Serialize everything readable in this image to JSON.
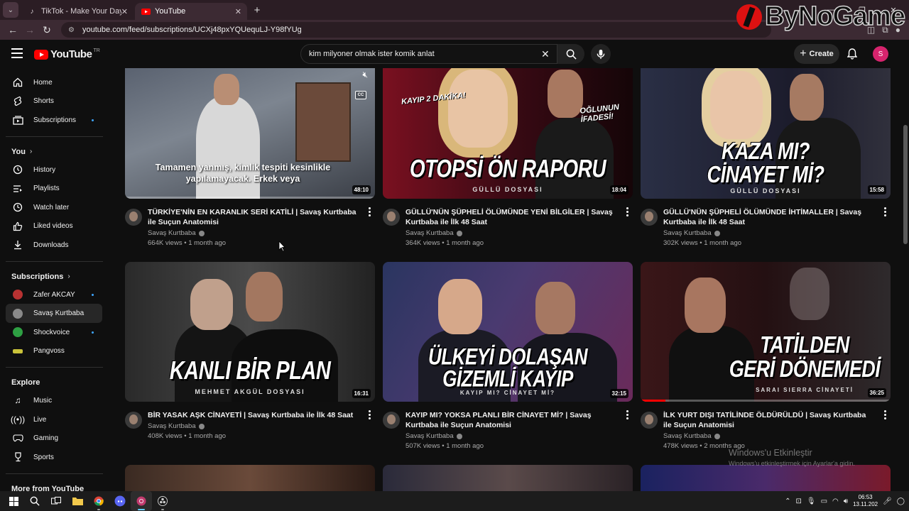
{
  "browser": {
    "tabs": [
      {
        "title": "TikTok - Make Your Day",
        "active": false
      },
      {
        "title": "YouTube",
        "active": true
      }
    ],
    "url": "youtube.com/feed/subscriptions/UCXj48pxYQUequLJ-Y98fYUg"
  },
  "watermark": {
    "text": "ByNoGame"
  },
  "header": {
    "logo_text": "YouTube",
    "logo_region": "TR",
    "search_value": "kim milyoner olmak ister komik anlat",
    "create_label": "Create",
    "avatar_letter": "S"
  },
  "sidebar": {
    "main": [
      {
        "label": "Home",
        "icon": "home-icon"
      },
      {
        "label": "Shorts",
        "icon": "shorts-icon"
      },
      {
        "label": "Subscriptions",
        "icon": "subscriptions-icon",
        "dot": true
      }
    ],
    "you_heading": "You",
    "you": [
      {
        "label": "History",
        "icon": "history-icon"
      },
      {
        "label": "Playlists",
        "icon": "playlists-icon"
      },
      {
        "label": "Watch later",
        "icon": "watch-later-icon"
      },
      {
        "label": "Liked videos",
        "icon": "liked-icon"
      },
      {
        "label": "Downloads",
        "icon": "download-icon"
      }
    ],
    "subs_heading": "Subscriptions",
    "subs": [
      {
        "label": "Zafer AKCAY",
        "color": "#b83232",
        "dot": true
      },
      {
        "label": "Savaş Kurtbaba",
        "color": "#8a8a8a",
        "active": true
      },
      {
        "label": "Shockvoice",
        "color": "#2ea043",
        "dot": true
      },
      {
        "label": "Pangvoss",
        "color": "#c9c23a"
      }
    ],
    "explore_heading": "Explore",
    "explore": [
      {
        "label": "Music",
        "icon": "music-icon"
      },
      {
        "label": "Live",
        "icon": "live-icon"
      },
      {
        "label": "Gaming",
        "icon": "gaming-icon"
      },
      {
        "label": "Sports",
        "icon": "sports-icon"
      }
    ],
    "more_heading": "More from YouTube"
  },
  "videos": [
    {
      "title": "TÜRKİYE'NİN EN KARANLIK SERİ KATİLİ | Savaş Kurtbaba ile Suçun Anatomisi",
      "channel": "Savaş Kurtbaba",
      "views": "664K views",
      "age": "1 month ago",
      "duration": "48:10",
      "caption_text": "Tamamen yanmış, kimlik tespiti kesinlikle yapılamayacak. Erkek veya"
    },
    {
      "title": "GÜLLÜ'NÜN ŞÜPHELİ ÖLÜMÜNDE YENİ BİLGİLER | Savaş Kurtbaba ile İlk 48 Saat",
      "channel": "Savaş Kurtbaba",
      "views": "364K views",
      "age": "1 month ago",
      "duration": "18:04",
      "thumb_title": "OTOPSİ ÖN RAPORU",
      "thumb_sub": "GÜLLÜ DOSYASI",
      "tag_left": "KAYIP 2 DAKİKA!",
      "tag_right": "OĞLUNUN İFADESİ!"
    },
    {
      "title": "GÜLLÜ'NÜN ŞÜPHELİ ÖLÜMÜNDE İHTİMALLER | Savaş Kurtbaba ile İlk 48 Saat",
      "channel": "Savaş Kurtbaba",
      "views": "302K views",
      "age": "1 month ago",
      "duration": "15:58",
      "thumb_title_1": "KAZA MI?",
      "thumb_title_2": "CİNAYET Mİ?",
      "thumb_sub": "GÜLLÜ DOSYASI"
    },
    {
      "title": "BİR YASAK AŞK CİNAYETİ | Savaş Kurtbaba ile İlk 48 Saat",
      "channel": "Savaş Kurtbaba",
      "views": "408K views",
      "age": "1 month ago",
      "duration": "16:31",
      "thumb_title": "KANLI BİR PLAN",
      "thumb_sub": "MEHMET AKGÜL DOSYASI"
    },
    {
      "title": "KAYIP MI? YOKSA PLANLI BİR CİNAYET Mİ? | Savaş Kurtbaba ile Suçun Anatomisi",
      "channel": "Savaş Kurtbaba",
      "views": "507K views",
      "age": "1 month ago",
      "duration": "32:15",
      "thumb_title_1": "ÜLKEYİ DOLAŞAN",
      "thumb_title_2": "GİZEMLİ KAYIP",
      "thumb_sub": "KAYIP MI? CİNAYET Mİ?"
    },
    {
      "title": "İLK YURT DIŞI TATİLİNDE ÖLDÜRÜLDÜ | Savaş Kurtbaba ile Suçun Anatomisi",
      "channel": "Savaş Kurtbaba",
      "views": "478K views",
      "age": "2 months ago",
      "duration": "36:25",
      "thumb_title_1": "TATİLDEN",
      "thumb_title_2": "GERİ DÖNEMEDİ",
      "thumb_sub": "SARAI SIERRA CİNAYETİ"
    }
  ],
  "activation": {
    "line1": "Windows'u Etkinleştir",
    "line2": "Windows'u etkinleştirmek için Ayarlar'a gidin."
  },
  "taskbar": {
    "time": "06:53",
    "date": "13.11.202"
  }
}
